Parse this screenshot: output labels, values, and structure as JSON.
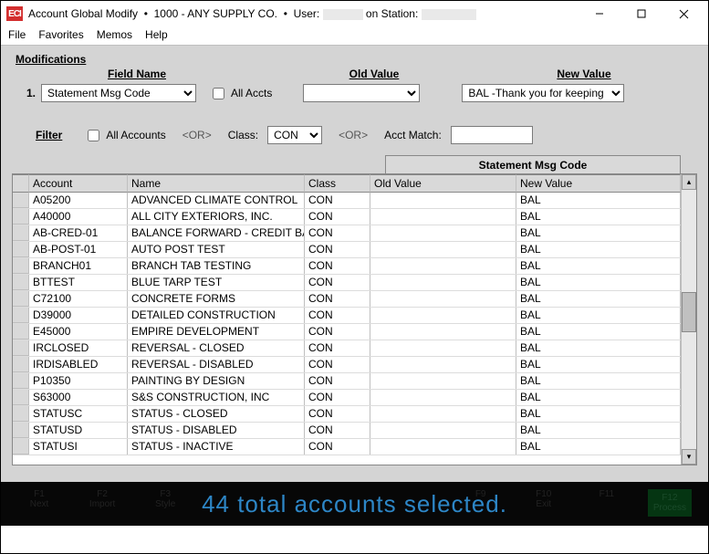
{
  "titlebar": {
    "app_prefix": "Account Global Modify",
    "dot": "•",
    "company": "1000 - ANY SUPPLY CO.",
    "user_label": "User:",
    "station_label": "on Station:"
  },
  "menu": {
    "file": "File",
    "favorites": "Favorites",
    "memos": "Memos",
    "help": "Help"
  },
  "headers": {
    "modifications": "Modifications",
    "field_name": "Field Name",
    "old_value": "Old Value",
    "new_value": "New Value"
  },
  "row1": {
    "num": "1.",
    "field_name_selected": "Statement Msg Code",
    "all_accts": "All Accts",
    "old_value_selected": "",
    "new_value_selected": "BAL  -Thank you for keeping y"
  },
  "filter": {
    "label": "Filter",
    "all_accounts": "All Accounts",
    "or": "<OR>",
    "class_label": "Class:",
    "class_selected": "CON",
    "acct_match_label": "Acct Match:",
    "acct_match_value": ""
  },
  "grid": {
    "group_header": "Statement Msg Code",
    "columns": {
      "account": "Account",
      "name": "Name",
      "class": "Class",
      "old": "Old Value",
      "new": "New Value"
    },
    "rows": [
      {
        "acct": "A05200",
        "name": "ADVANCED CLIMATE CONTROL",
        "class": "CON",
        "old": "",
        "new": "BAL"
      },
      {
        "acct": "A40000",
        "name": "ALL CITY EXTERIORS, INC.",
        "class": "CON",
        "old": "",
        "new": "BAL"
      },
      {
        "acct": "AB-CRED-01",
        "name": "BALANCE FORWARD - CREDIT BAL",
        "class": "CON",
        "old": "",
        "new": "BAL"
      },
      {
        "acct": "AB-POST-01",
        "name": "AUTO POST TEST",
        "class": "CON",
        "old": "",
        "new": "BAL"
      },
      {
        "acct": "BRANCH01",
        "name": "BRANCH TAB TESTING",
        "class": "CON",
        "old": "",
        "new": "BAL"
      },
      {
        "acct": "BTTEST",
        "name": "BLUE TARP TEST",
        "class": "CON",
        "old": "",
        "new": "BAL"
      },
      {
        "acct": "C72100",
        "name": "CONCRETE FORMS",
        "class": "CON",
        "old": "",
        "new": "BAL"
      },
      {
        "acct": "D39000",
        "name": "DETAILED CONSTRUCTION",
        "class": "CON",
        "old": "",
        "new": "BAL"
      },
      {
        "acct": "E45000",
        "name": "EMPIRE DEVELOPMENT",
        "class": "CON",
        "old": "",
        "new": "BAL"
      },
      {
        "acct": "IRCLOSED",
        "name": "REVERSAL - CLOSED",
        "class": "CON",
        "old": "",
        "new": "BAL"
      },
      {
        "acct": "IRDISABLED",
        "name": "REVERSAL - DISABLED",
        "class": "CON",
        "old": "",
        "new": "BAL"
      },
      {
        "acct": "P10350",
        "name": "PAINTING BY DESIGN",
        "class": "CON",
        "old": "",
        "new": "BAL"
      },
      {
        "acct": "S63000",
        "name": "S&S CONSTRUCTION, INC",
        "class": "CON",
        "old": "",
        "new": "BAL"
      },
      {
        "acct": "STATUSC",
        "name": "STATUS - CLOSED",
        "class": "CON",
        "old": "",
        "new": "BAL"
      },
      {
        "acct": "STATUSD",
        "name": "STATUS - DISABLED",
        "class": "CON",
        "old": "",
        "new": "BAL"
      },
      {
        "acct": "STATUSI",
        "name": "STATUS - INACTIVE",
        "class": "CON",
        "old": "",
        "new": "BAL"
      }
    ]
  },
  "banner": {
    "text": "44 total accounts selected."
  },
  "fkeys": {
    "f1": "F1\nNext",
    "f2": "F2\nImport",
    "f3": "F3\nStyle",
    "f9": "F9",
    "f10": "F10\nExit",
    "f11": "F11",
    "f12": "F12\nProcess"
  }
}
